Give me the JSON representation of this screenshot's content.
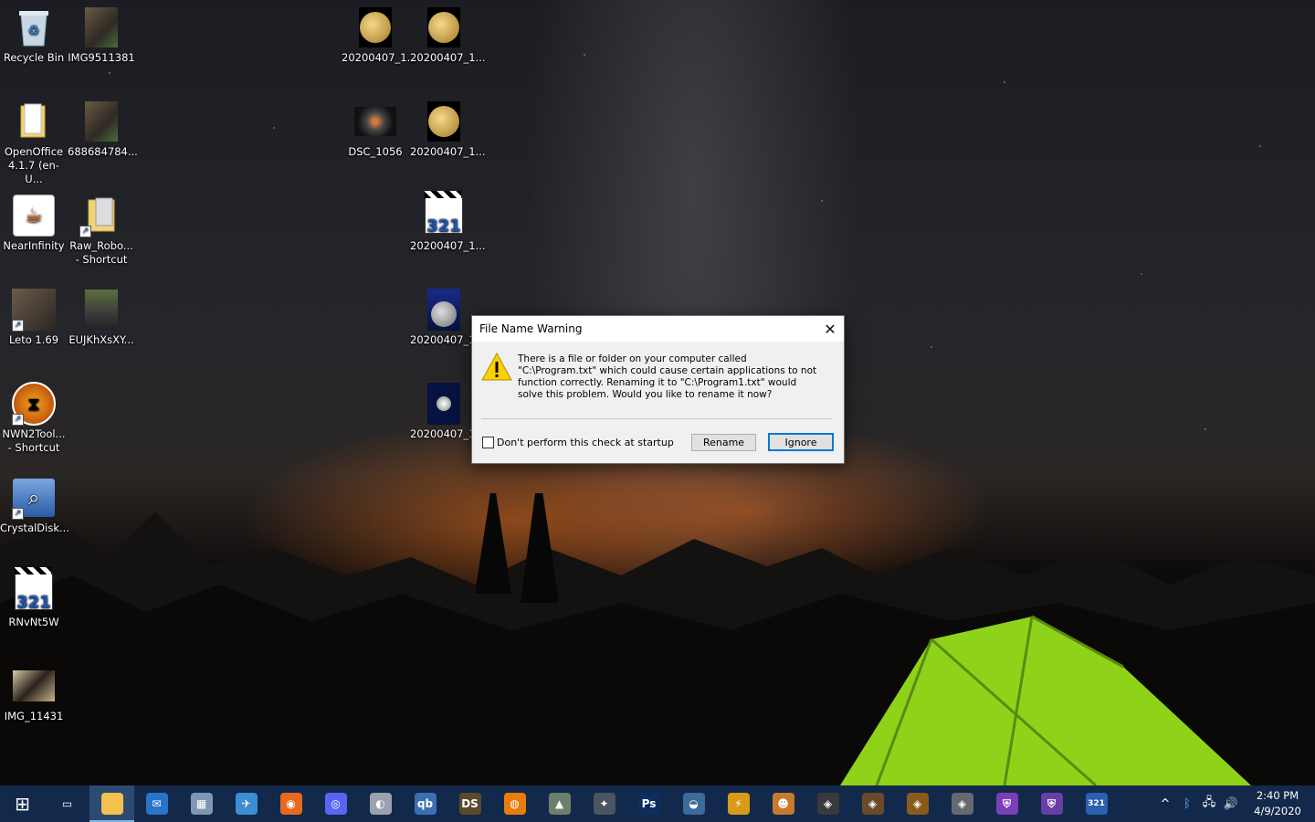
{
  "desktop_icons": [
    {
      "label": "Recycle Bin",
      "icon": "recycle-bin-icon"
    },
    {
      "label": "IMG9511381",
      "icon": "photo-icon"
    },
    {
      "label": "20200407_1...",
      "icon": "moon-photo-icon"
    },
    {
      "label": "20200407_1...",
      "icon": "moon-photo-icon"
    },
    {
      "label": "OpenOffice 4.1.7 (en-U...",
      "icon": "folder-icon"
    },
    {
      "label": "688684784...",
      "icon": "photo-icon"
    },
    {
      "label": "DSC_1056",
      "icon": "photo-icon"
    },
    {
      "label": "20200407_1...",
      "icon": "moon-photo-icon"
    },
    {
      "label": "NearInfinity",
      "icon": "java-icon"
    },
    {
      "label": "Raw_Robo... - Shortcut",
      "icon": "folder-shortcut-icon"
    },
    {
      "label": "20200407_1...",
      "icon": "media-player-icon"
    },
    {
      "label": "Leto 1.69",
      "icon": "app-shortcut-icon"
    },
    {
      "label": "EUJKhXsXY...",
      "icon": "photo-icon"
    },
    {
      "label": "20200407_1...",
      "icon": "moon-photo-icon"
    },
    {
      "label": "NWN2Tool... - Shortcut",
      "icon": "app-shortcut-icon"
    },
    {
      "label": "20200407_1...",
      "icon": "moon-photo-icon"
    },
    {
      "label": "CrystalDisk...",
      "icon": "disk-tool-icon"
    },
    {
      "label": "RNvNt5W",
      "icon": "media-player-icon"
    },
    {
      "label": "IMG_11431",
      "icon": "photo-icon"
    }
  ],
  "dialog": {
    "title": "File Name Warning",
    "message": "There is a file or folder on your computer called \"C:\\Program.txt\" which could cause certain applications to not function correctly. Renaming it to \"C:\\Program1.txt\" would solve this problem.  Would you like to rename it now?",
    "checkbox_label": "Don't perform this check at startup",
    "rename_label": "Rename",
    "ignore_label": "Ignore",
    "close_glyph": "✕"
  },
  "taskbar": {
    "start_glyph": "⊞",
    "items": [
      {
        "icon": "task-view-icon",
        "glyph": "▭",
        "color": "#13294b"
      },
      {
        "icon": "file-explorer-icon",
        "glyph": "",
        "color": "#f2c14e"
      },
      {
        "icon": "outlook-icon",
        "glyph": "✉",
        "color": "#2a74c9"
      },
      {
        "icon": "system-app-icon",
        "glyph": "▦",
        "color": "#7f97b2"
      },
      {
        "icon": "thunderbird-icon",
        "glyph": "✈",
        "color": "#3b8ed4"
      },
      {
        "icon": "firefox-icon",
        "glyph": "◉",
        "color": "#e66a1f"
      },
      {
        "icon": "discord-icon",
        "glyph": "◎",
        "color": "#5865f2"
      },
      {
        "icon": "globe-app-icon",
        "glyph": "◐",
        "color": "#9aa3ad"
      },
      {
        "icon": "qbittorrent-icon",
        "glyph": "qb",
        "color": "#3d6fb3"
      },
      {
        "icon": "daz-studio-icon",
        "glyph": "DS",
        "color": "#5a4a2a"
      },
      {
        "icon": "blender-icon",
        "glyph": "◍",
        "color": "#e87d0d"
      },
      {
        "icon": "game-app-icon",
        "glyph": "▲",
        "color": "#6b7f6a"
      },
      {
        "icon": "starship-app-icon",
        "glyph": "✦",
        "color": "#4b5560"
      },
      {
        "icon": "photoshop-icon",
        "glyph": "Ps",
        "color": "#0b2e5f"
      },
      {
        "icon": "disc-app-icon",
        "glyph": "◒",
        "color": "#3c6a99"
      },
      {
        "icon": "winamp-icon",
        "glyph": "⚡",
        "color": "#d99a1a"
      },
      {
        "icon": "monkey-app-icon",
        "glyph": "☻",
        "color": "#c77a2d"
      },
      {
        "icon": "game-launcher-icon",
        "glyph": "◈",
        "color": "#3a3a3a"
      },
      {
        "icon": "game-launcher-icon",
        "glyph": "◈",
        "color": "#6a4a2a"
      },
      {
        "icon": "game-launcher-icon",
        "glyph": "◈",
        "color": "#8a5a1a"
      },
      {
        "icon": "game-launcher-icon",
        "glyph": "◈",
        "color": "#666a70"
      },
      {
        "icon": "shield-app-icon",
        "glyph": "⛨",
        "color": "#7a3fb5"
      },
      {
        "icon": "shield-app-icon",
        "glyph": "⛨",
        "color": "#6a3fa5"
      },
      {
        "icon": "media-player-icon",
        "glyph": "321",
        "color": "#2b5fb0"
      }
    ],
    "tray": {
      "chevron": "^",
      "bluetooth": "ᛒ",
      "network": "🖧",
      "volume": "🔊",
      "time": "2:40 PM",
      "date": "4/9/2020"
    }
  }
}
